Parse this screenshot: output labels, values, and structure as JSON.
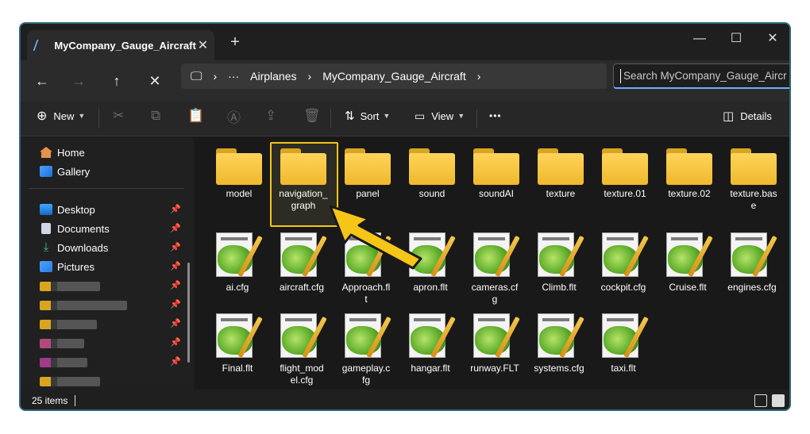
{
  "window": {
    "tab_title": "MyCompany_Gauge_Aircraft",
    "tab_close": "✕",
    "new_tab": "+",
    "minimize": "—",
    "maximize": "☐",
    "close": "✕"
  },
  "nav": {
    "back": "←",
    "forward": "→",
    "up": "↑",
    "refresh": "✕"
  },
  "address": {
    "monitor": "🖵",
    "sep1": "›",
    "ellipsis": "···",
    "crumb1": "Airplanes",
    "sep2": "›",
    "crumb2": "MyCompany_Gauge_Aircraft",
    "sep3": "›"
  },
  "search": {
    "placeholder": "Search MyCompany_Gauge_Aircr"
  },
  "toolbar": {
    "new_icon": "⊕",
    "new_label": "New",
    "cut_icon": "✂",
    "copy_icon": "⧉",
    "paste_icon": "📋",
    "rename_icon": "Ⓐ",
    "share_icon": "⇪",
    "delete_icon": "🗑",
    "sort_icon": "⇅",
    "sort_label": "Sort",
    "view_icon": "▭",
    "view_label": "View",
    "more": "•••",
    "details_icon": "◫",
    "details_label": "Details"
  },
  "sidebar": {
    "home": "Home",
    "gallery": "Gallery",
    "desktop": "Desktop",
    "documents": "Documents",
    "downloads": "Downloads",
    "pictures": "Pictures",
    "pin": "📌"
  },
  "folders": [
    "model",
    "navigation_\ngraph",
    "panel",
    "sound",
    "soundAI",
    "texture",
    "texture.01",
    "texture.02",
    "texture.bas\ne"
  ],
  "files_row2": [
    "ai.cfg",
    "aircraft.cfg",
    "Approach.fl\nt",
    "apron.flt",
    "cameras.cf\ng",
    "Climb.flt",
    "cockpit.cfg",
    "Cruise.flt",
    "engines.cfg"
  ],
  "files_row3": [
    "Final.flt",
    "flight_mod\nel.cfg",
    "gameplay.c\nfg",
    "hangar.flt",
    "runway.FLT",
    "systems.cfg",
    "taxi.flt"
  ],
  "status": {
    "count": "25 items"
  },
  "colors": {
    "accent": "#6ab0ff",
    "highlight": "#f5c518",
    "window_border": "#2b6a78"
  }
}
